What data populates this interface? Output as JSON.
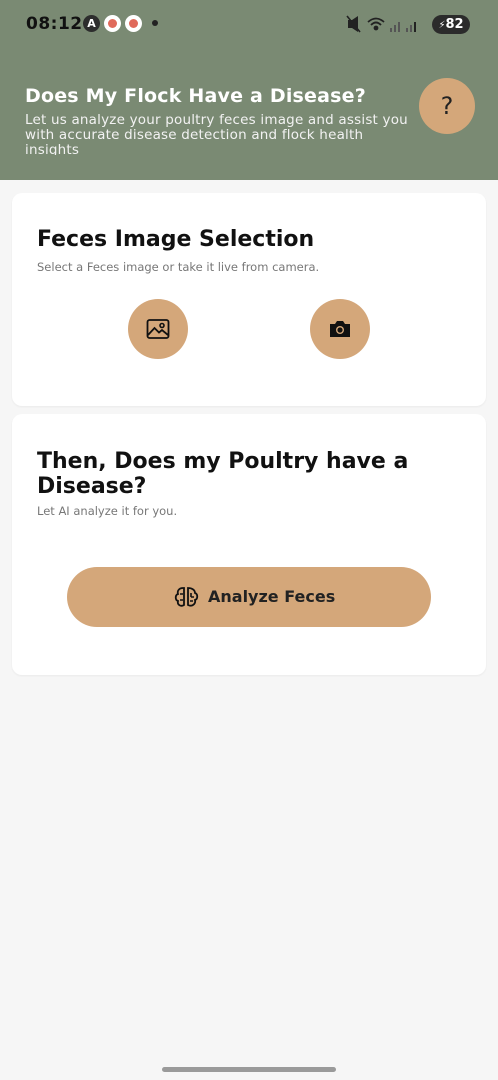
{
  "status_bar": {
    "time": "08:12",
    "notif_a": "A",
    "battery": "82"
  },
  "header": {
    "title": "Does My Flock Have a Disease?",
    "subtitle": "Let us analyze your poultry feces image and assist you with accurate disease detection and flock health insights",
    "help_label": "?"
  },
  "selection_card": {
    "title": "Feces Image Selection",
    "subtitle": "Select a Feces image or take it live from camera.",
    "gallery_icon": "image-icon",
    "camera_icon": "camera-icon"
  },
  "analyze_card": {
    "title": "Then, Does my Poultry have a Disease?",
    "subtitle": "Let AI analyze it for you.",
    "button_label": "Analyze Feces",
    "button_icon": "brain-icon"
  },
  "colors": {
    "header_bg": "#7a8a73",
    "accent": "#d4a77a",
    "page_bg": "#f6f6f6"
  }
}
